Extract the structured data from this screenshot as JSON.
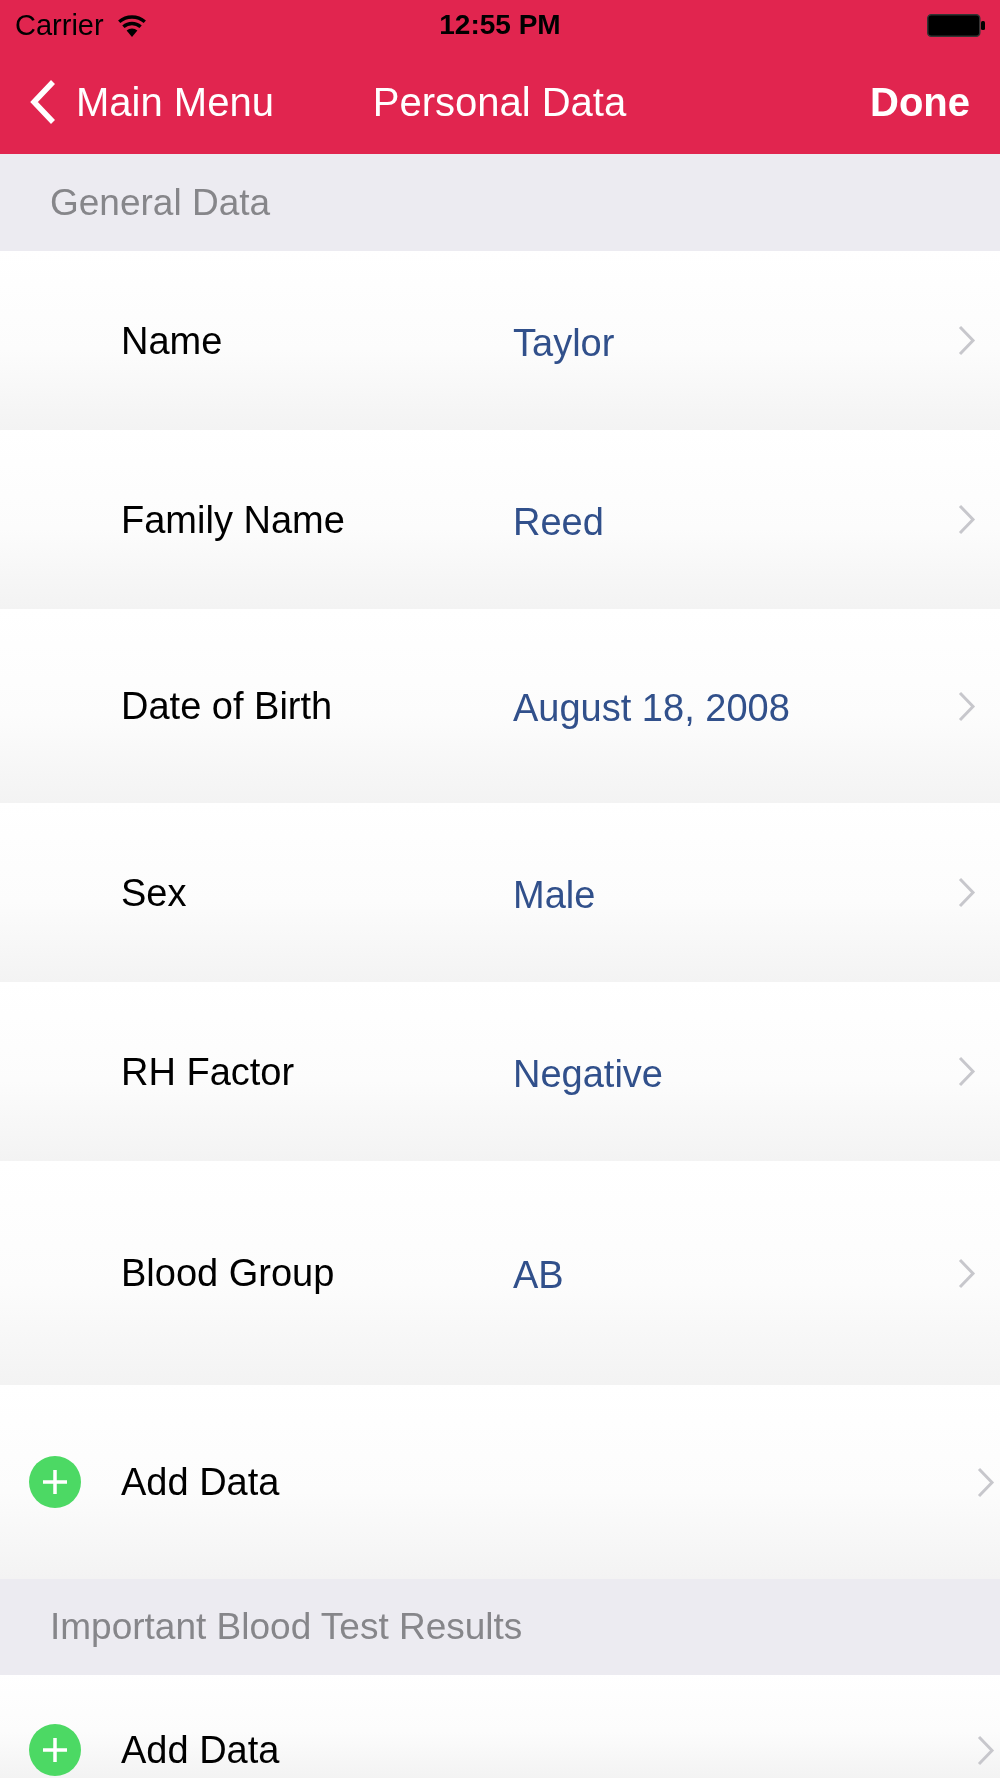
{
  "status_bar": {
    "carrier": "Carrier",
    "time": "12:55 PM"
  },
  "nav_bar": {
    "back": "Main Menu",
    "title": "Personal Data",
    "action": "Done"
  },
  "sections": [
    {
      "header": "General Data",
      "rows": [
        {
          "kind": "field",
          "label": "Name",
          "value": "Taylor"
        },
        {
          "kind": "field",
          "label": "Family Name",
          "value": "Reed"
        },
        {
          "kind": "field",
          "label": "Date of Birth",
          "value": "August 18, 2008"
        },
        {
          "kind": "field",
          "label": "Sex",
          "value": "Male"
        },
        {
          "kind": "field",
          "label": "RH Factor",
          "value": "Negative"
        },
        {
          "kind": "field",
          "label": "Blood Group",
          "value": "AB"
        },
        {
          "kind": "add",
          "label": "Add Data"
        }
      ]
    },
    {
      "header": "Important Blood Test Results",
      "rows": [
        {
          "kind": "add",
          "label": "Add Data"
        }
      ]
    }
  ]
}
